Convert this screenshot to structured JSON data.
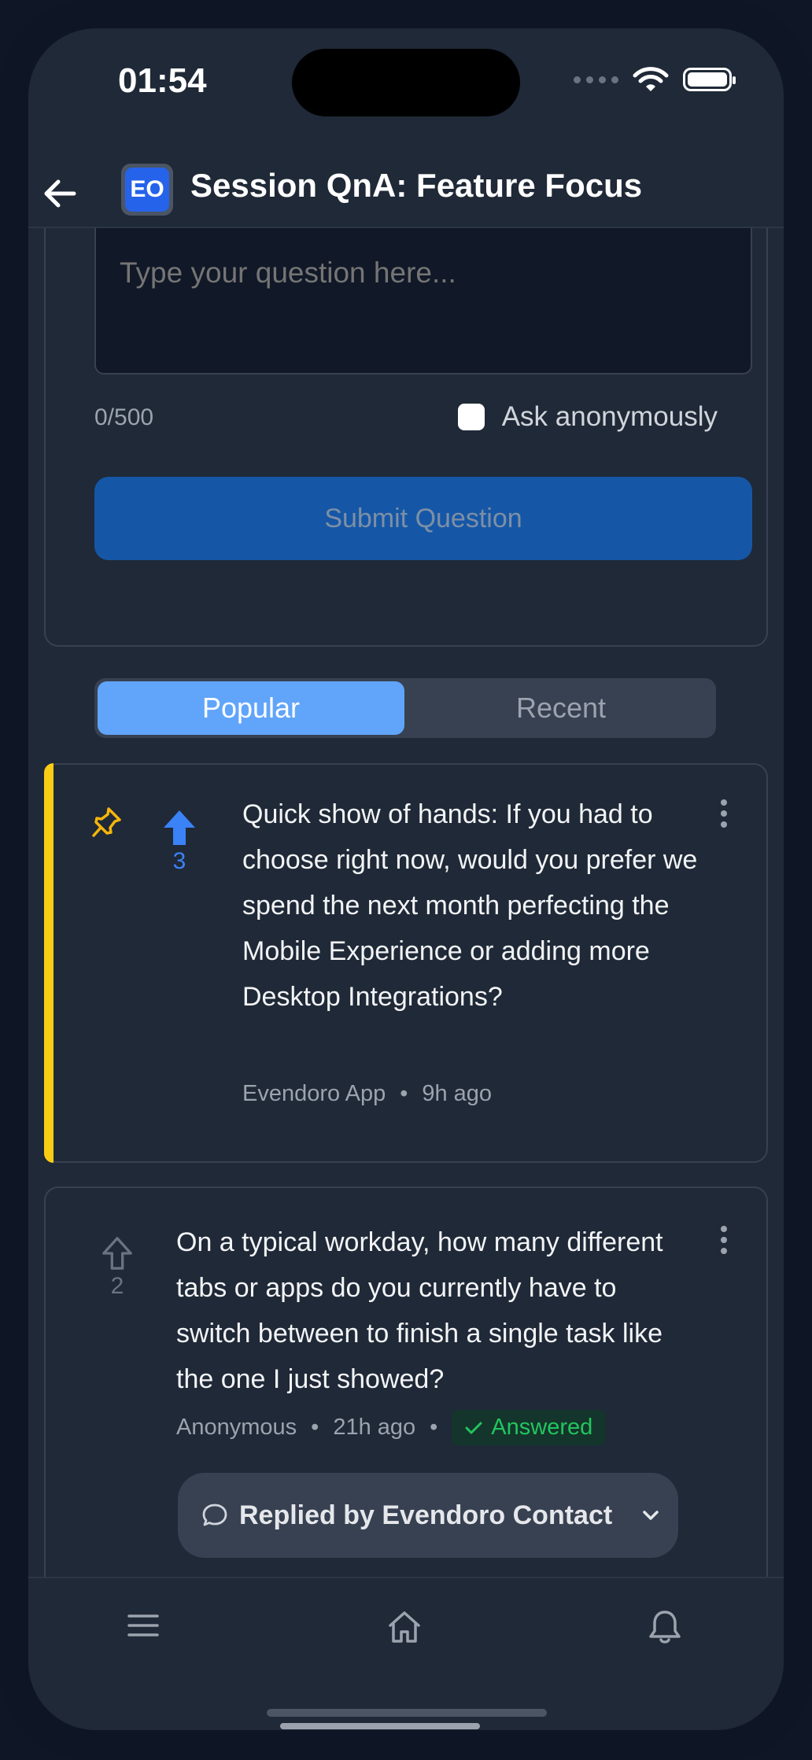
{
  "status_bar": {
    "time": "01:54"
  },
  "header": {
    "logo_text": "EO",
    "title": "Session QnA: Feature Focus"
  },
  "ask_form": {
    "placeholder": "Type your question here...",
    "counter": "0/500",
    "anonymous_label": "Ask anonymously",
    "submit_label": "Submit Question"
  },
  "sort_tabs": {
    "popular": "Popular",
    "recent": "Recent",
    "selected": "Popular"
  },
  "questions": [
    {
      "pinned": true,
      "votes": "3",
      "upvoted": true,
      "text": "Quick show of hands: If you had to choose right now, would you prefer we spend the next month perfecting the Mobile Experience or adding more Desktop Integrations?",
      "author": "Evendoro App",
      "separator": "•",
      "time": "9h ago"
    },
    {
      "pinned": false,
      "votes": "2",
      "upvoted": false,
      "text": "On a typical workday, how many different tabs or apps do you currently have to switch between to finish a single task like the one I just showed?",
      "author": "Anonymous",
      "separator": "•",
      "time": "21h ago",
      "status": "Answered",
      "reply_label": "Replied by Evendoro Contact"
    }
  ],
  "tab_bar": {
    "items": [
      "menu-icon",
      "home-icon",
      "bell-icon"
    ]
  },
  "colors": {
    "accent": "#60a5fa",
    "pin": "#facc15",
    "answered": "#22c55e",
    "submit": "#1557a6"
  }
}
